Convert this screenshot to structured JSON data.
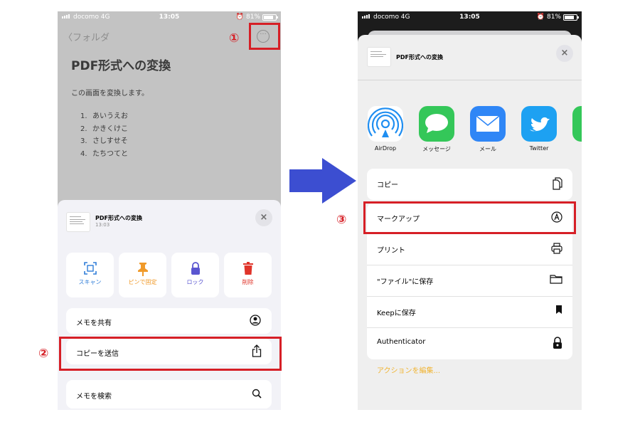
{
  "left": {
    "status": {
      "carrier": "docomo 4G",
      "time": "13:05",
      "battery": "81%"
    },
    "nav": {
      "back_label": "フォルダ"
    },
    "note": {
      "title": "PDF形式への変換",
      "body": "この画面を変換します。",
      "list": [
        {
          "num": "1.",
          "text": "あいうえお"
        },
        {
          "num": "2.",
          "text": "かきくけこ"
        },
        {
          "num": "3.",
          "text": "さしすせそ"
        },
        {
          "num": "4.",
          "text": "たちつてと"
        }
      ]
    },
    "sheet": {
      "title": "PDF形式への変換",
      "time": "13:03",
      "close": "×",
      "tiles": [
        {
          "label": "スキャン",
          "color": "#2f7dd8"
        },
        {
          "label": "ピンで固定",
          "color": "#f09a2a"
        },
        {
          "label": "ロック",
          "color": "#5a56d0"
        },
        {
          "label": "削除",
          "color": "#e0342a"
        }
      ],
      "rows": [
        "メモを共有",
        "コピーを送信",
        "メモを検索"
      ]
    }
  },
  "right": {
    "status": {
      "carrier": "docomo 4G",
      "time": "13:05",
      "battery": "81%"
    },
    "share": {
      "title": "PDF形式への変換",
      "close": "×",
      "apps": [
        "AirDrop",
        "メッセージ",
        "メール",
        "Twitter"
      ],
      "actions_group1": [
        "コピー"
      ],
      "actions_group2": [
        "マークアップ",
        "プリント",
        "\"ファイル\"に保存",
        "Keepに保存",
        "Authenticator"
      ],
      "edit_link": "アクションを編集..."
    }
  },
  "callouts": [
    "①",
    "②",
    "③"
  ],
  "colors": {
    "highlight": "#d61f26",
    "arrow": "#3c4ed1",
    "accent": "#f0b432"
  }
}
